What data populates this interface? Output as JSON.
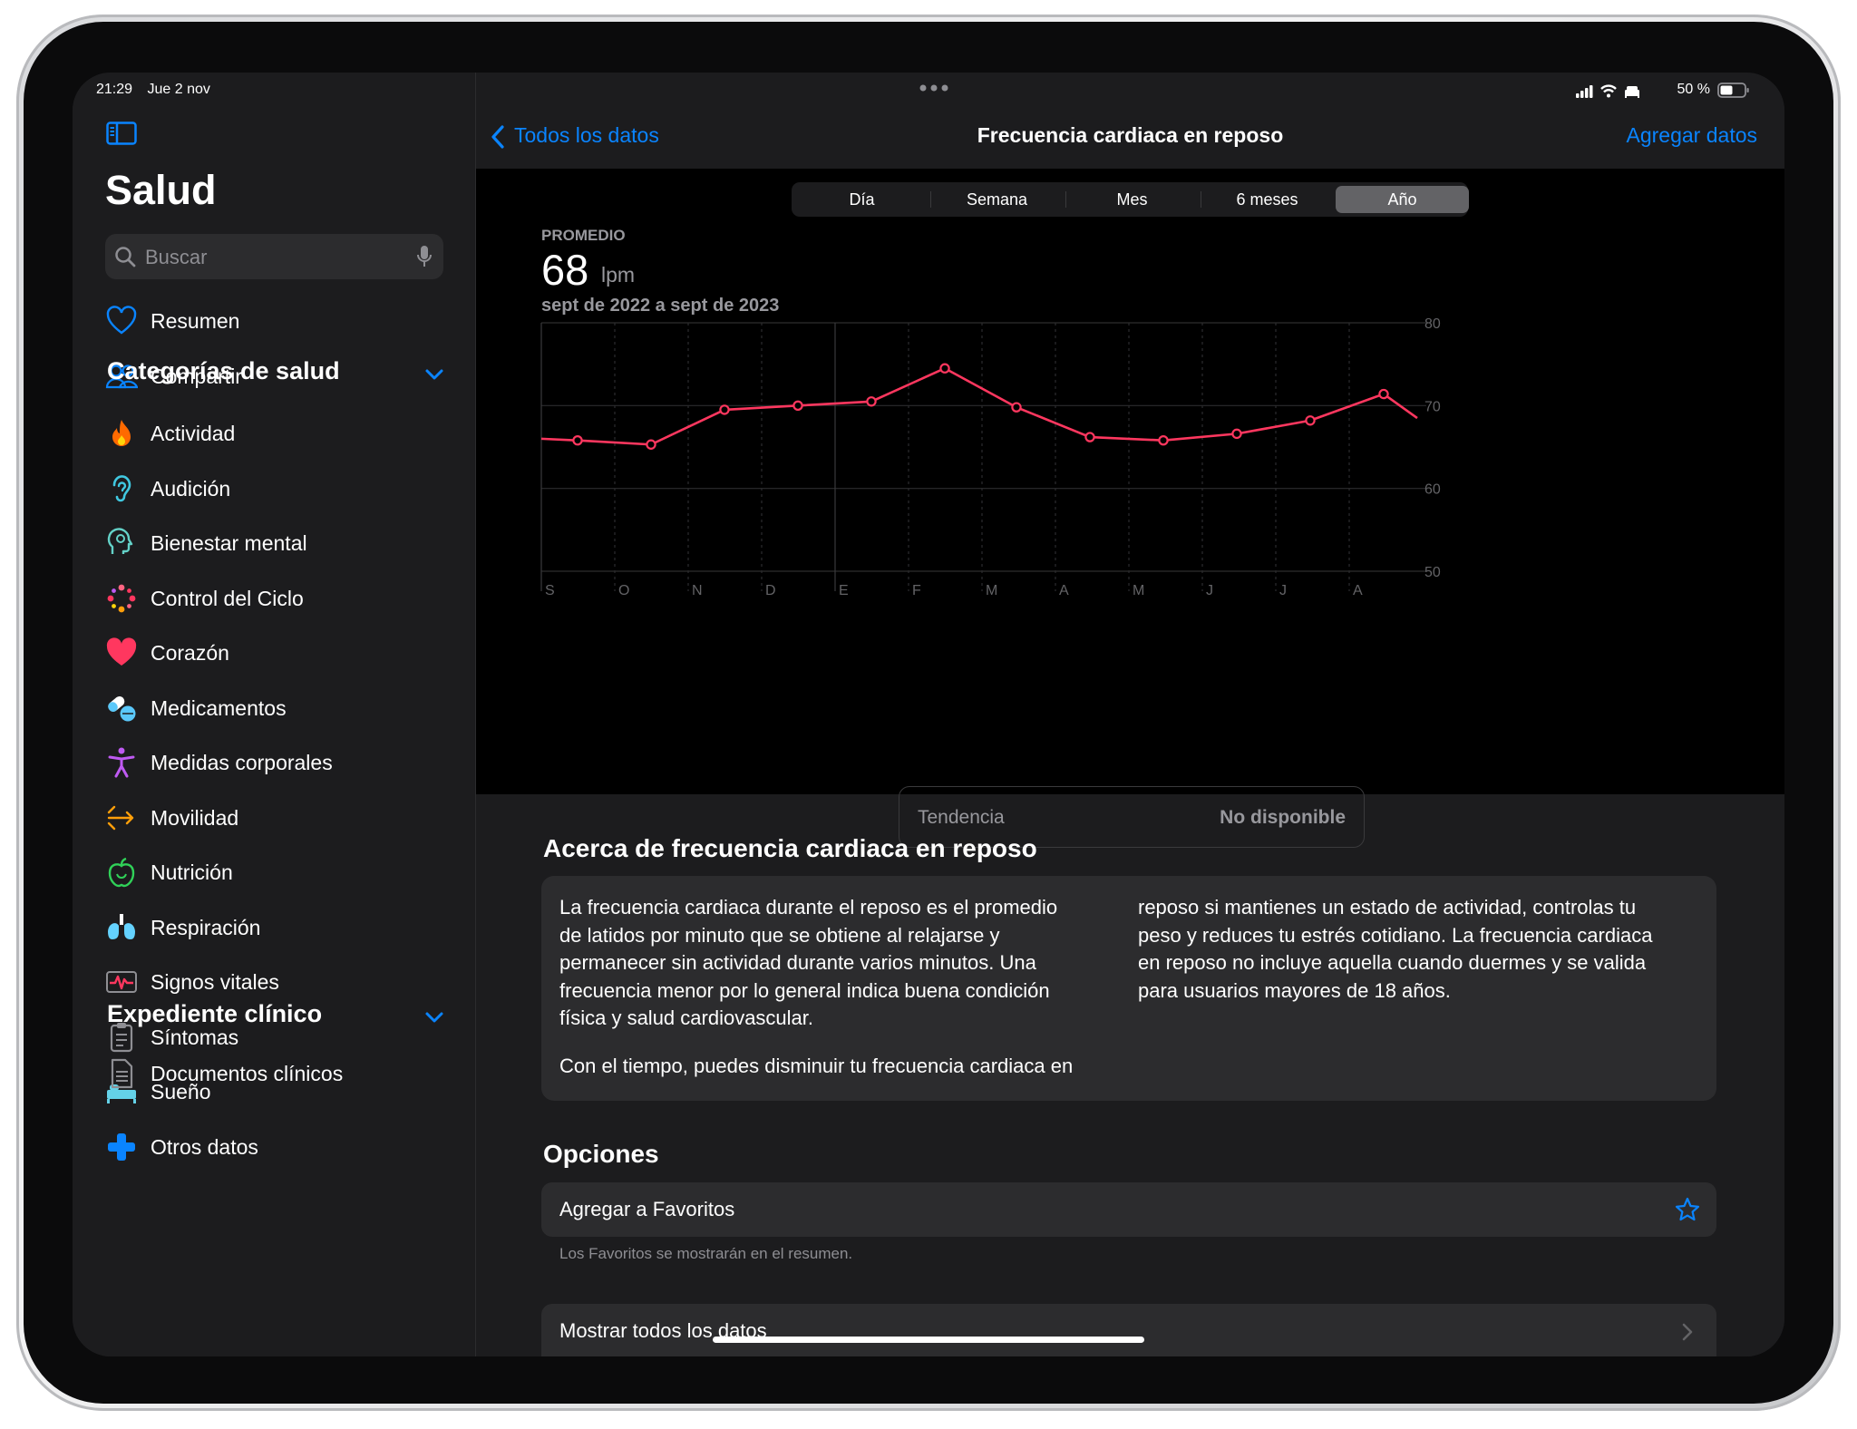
{
  "status": {
    "time": "21:29",
    "date": "Jue 2 nov",
    "battery": "50 %"
  },
  "sidebar": {
    "title": "Salud",
    "search_placeholder": "Buscar",
    "top_items": [
      {
        "label": "Resumen",
        "icon": "heart-outline-icon",
        "color": "#0a84ff"
      },
      {
        "label": "Compartir",
        "icon": "people-icon",
        "color": "#0a84ff"
      }
    ],
    "categories_title": "Categorías de salud",
    "categories": [
      {
        "label": "Actividad",
        "icon": "flame-icon",
        "color": "#ff6a00"
      },
      {
        "label": "Audición",
        "icon": "ear-icon",
        "color": "#40c8e0"
      },
      {
        "label": "Bienestar mental",
        "icon": "mind-icon",
        "color": "#64d2c8"
      },
      {
        "label": "Control del Ciclo",
        "icon": "cycle-dots-icon",
        "color": "#ff5a6e"
      },
      {
        "label": "Corazón",
        "icon": "heart-icon",
        "color": "#ff375f"
      },
      {
        "label": "Medicamentos",
        "icon": "pills-icon",
        "color": "#5ac8fa"
      },
      {
        "label": "Medidas corporales",
        "icon": "figure-icon",
        "color": "#bf5af2"
      },
      {
        "label": "Movilidad",
        "icon": "arrows-icon",
        "color": "#ff9f0a"
      },
      {
        "label": "Nutrición",
        "icon": "apple-icon",
        "color": "#30d158"
      },
      {
        "label": "Respiración",
        "icon": "lungs-icon",
        "color": "#64d2ff"
      },
      {
        "label": "Signos vitales",
        "icon": "vitals-icon",
        "color": "#ff375f"
      },
      {
        "label": "Síntomas",
        "icon": "clipboard-icon",
        "color": "#8e8e93"
      },
      {
        "label": "Sueño",
        "icon": "bed-icon",
        "color": "#64d2e8"
      },
      {
        "label": "Otros datos",
        "icon": "plus-icon",
        "color": "#0a84ff"
      }
    ],
    "clinical_title": "Expediente clínico",
    "clinical": [
      {
        "label": "Documentos clínicos",
        "icon": "document-icon",
        "color": "#8e8e93"
      }
    ]
  },
  "navbar": {
    "back_label": "Todos los datos",
    "title": "Frecuencia cardiaca en reposo",
    "action_label": "Agregar datos"
  },
  "segments": [
    {
      "label": "Día"
    },
    {
      "label": "Semana"
    },
    {
      "label": "Mes"
    },
    {
      "label": "6 meses"
    },
    {
      "label": "Año",
      "active": true
    }
  ],
  "summary": {
    "label": "PROMEDIO",
    "value": "68",
    "unit": "lpm",
    "range": "sept de 2022 a sept de 2023"
  },
  "chart_data": {
    "type": "line",
    "title": "",
    "x": [
      "S",
      "O",
      "N",
      "D",
      "E",
      "F",
      "M",
      "A",
      "M",
      "J",
      "J",
      "A"
    ],
    "series": [
      {
        "values": [
          65.8,
          65.3,
          69.5,
          70.0,
          70.5,
          74.5,
          69.8,
          66.2,
          65.8,
          66.6,
          68.2,
          71.4
        ]
      }
    ],
    "line_start": 66.0,
    "line_end": 68.5,
    "ylim": [
      50,
      80
    ],
    "yticks": [
      50,
      60,
      70,
      80
    ],
    "line_color": "#ff375f",
    "grid": true
  },
  "trend": {
    "label": "Tendencia",
    "value": "No disponible"
  },
  "about": {
    "title": "Acerca de frecuencia cardiaca en reposo",
    "col1_lines": [
      "La frecuencia cardiaca durante el reposo es el promedio",
      "de latidos por minuto que se obtiene al relajarse y",
      "permanecer sin actividad durante varios minutos. Una",
      "frecuencia menor por lo general indica buena condición",
      "física y salud cardiovascular.",
      "",
      "Con el tiempo, puedes disminuir tu frecuencia cardiaca en"
    ],
    "col2_lines": [
      "reposo si mantienes un estado de actividad, controlas tu",
      "peso y reduces tu estrés cotidiano. La frecuencia cardiaca",
      "en reposo no incluye aquella cuando duermes y se valida",
      "para usuarios mayores de 18 años."
    ]
  },
  "options": {
    "title": "Opciones",
    "favorite_label": "Agregar a Favoritos",
    "favorite_note": "Los Favoritos se mostrarán en el resumen.",
    "show_all_label": "Mostrar todos los datos"
  }
}
